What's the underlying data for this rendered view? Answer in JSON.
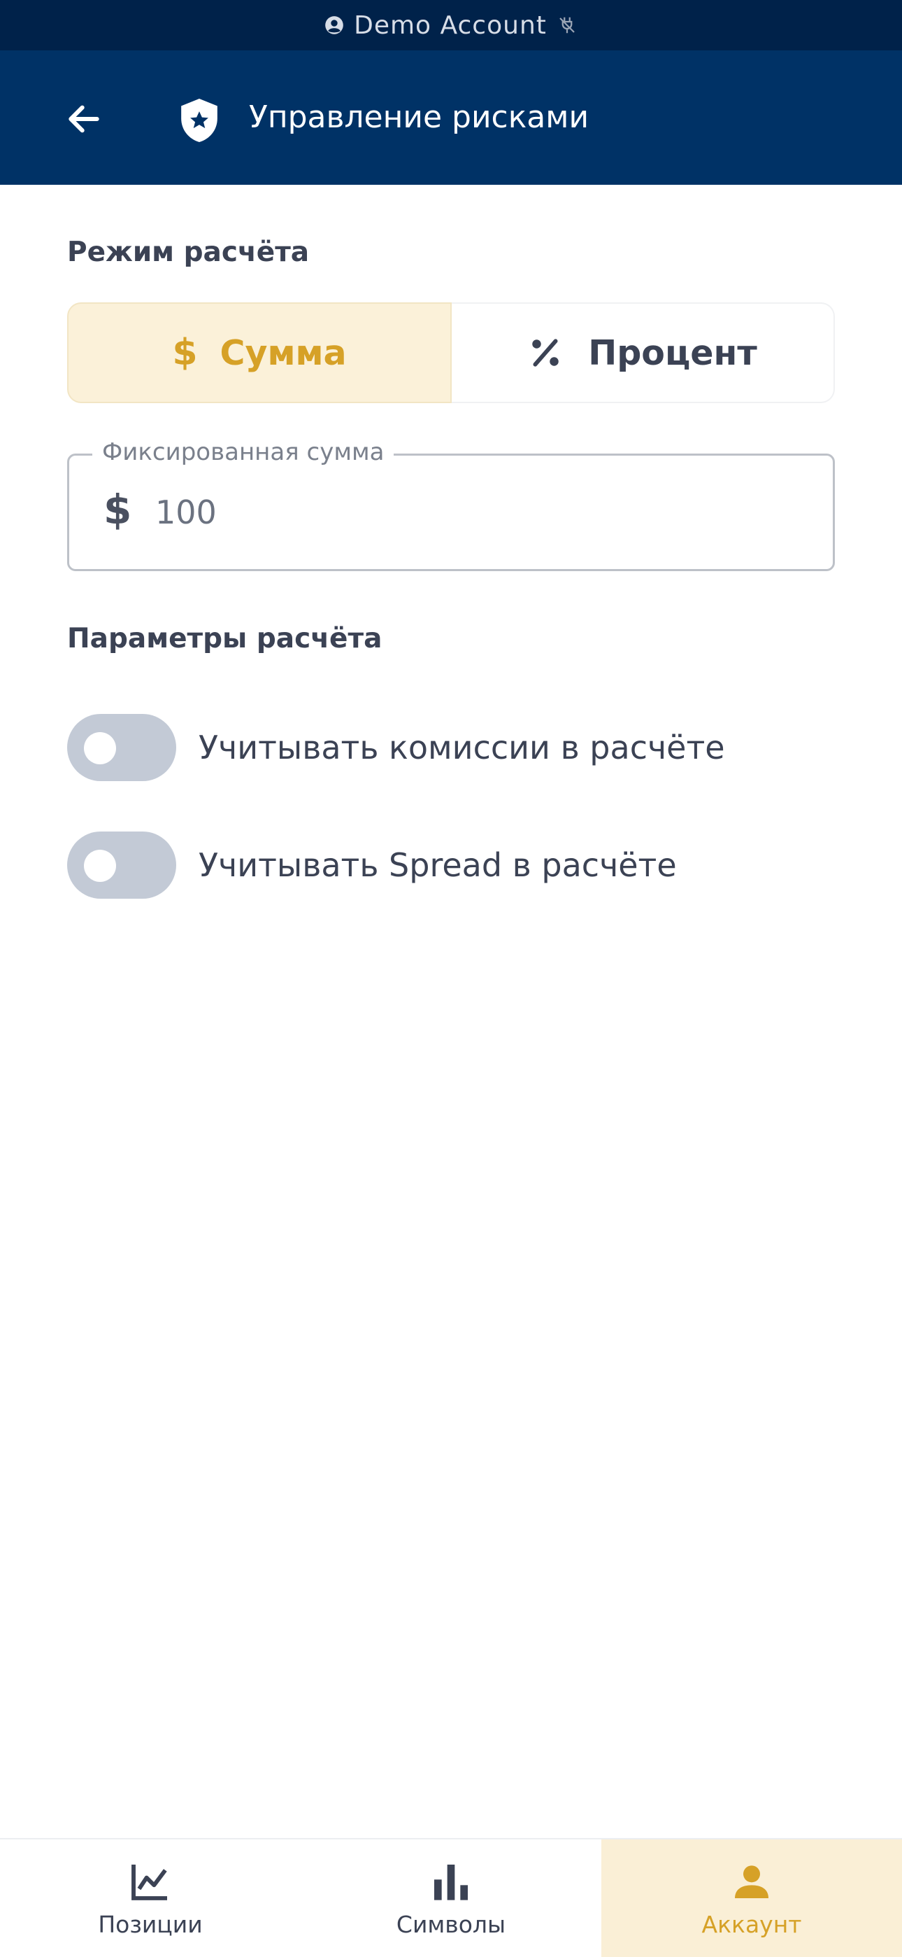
{
  "status_bar": {
    "account_label": "Demo Account",
    "account_icon": "account-circle-icon",
    "connection_icon": "no-connection-icon"
  },
  "app_bar": {
    "title": "Управление рисками",
    "back_icon": "arrow-left-icon",
    "title_icon": "shield-star-icon"
  },
  "calc_mode": {
    "label": "Режим расчёта",
    "options": [
      {
        "label": "Сумма",
        "icon": "dollar-icon",
        "selected": true
      },
      {
        "label": "Процент",
        "icon": "percent-icon",
        "selected": false
      }
    ]
  },
  "amount_field": {
    "legend": "Фиксированная сумма",
    "prefix": "$",
    "value": "100"
  },
  "calc_params": {
    "label": "Параметры расчёта",
    "toggles": [
      {
        "label": "Учитывать комиссии в расчёте",
        "on": false
      },
      {
        "label": "Учитывать Spread в расчёте",
        "on": false
      }
    ]
  },
  "bottom_nav": {
    "items": [
      {
        "label": "Позиции",
        "icon": "line-chart-icon",
        "active": false
      },
      {
        "label": "Символы",
        "icon": "bar-chart-icon",
        "active": false
      },
      {
        "label": "Аккаунт",
        "icon": "person-icon",
        "active": true
      }
    ]
  },
  "colors": {
    "status_bar_bg": "#00224a",
    "app_bar_bg": "#003266",
    "accent": "#d6a127",
    "accent_bg": "#fbf1d9",
    "toggle_off": "#c3cad6"
  }
}
